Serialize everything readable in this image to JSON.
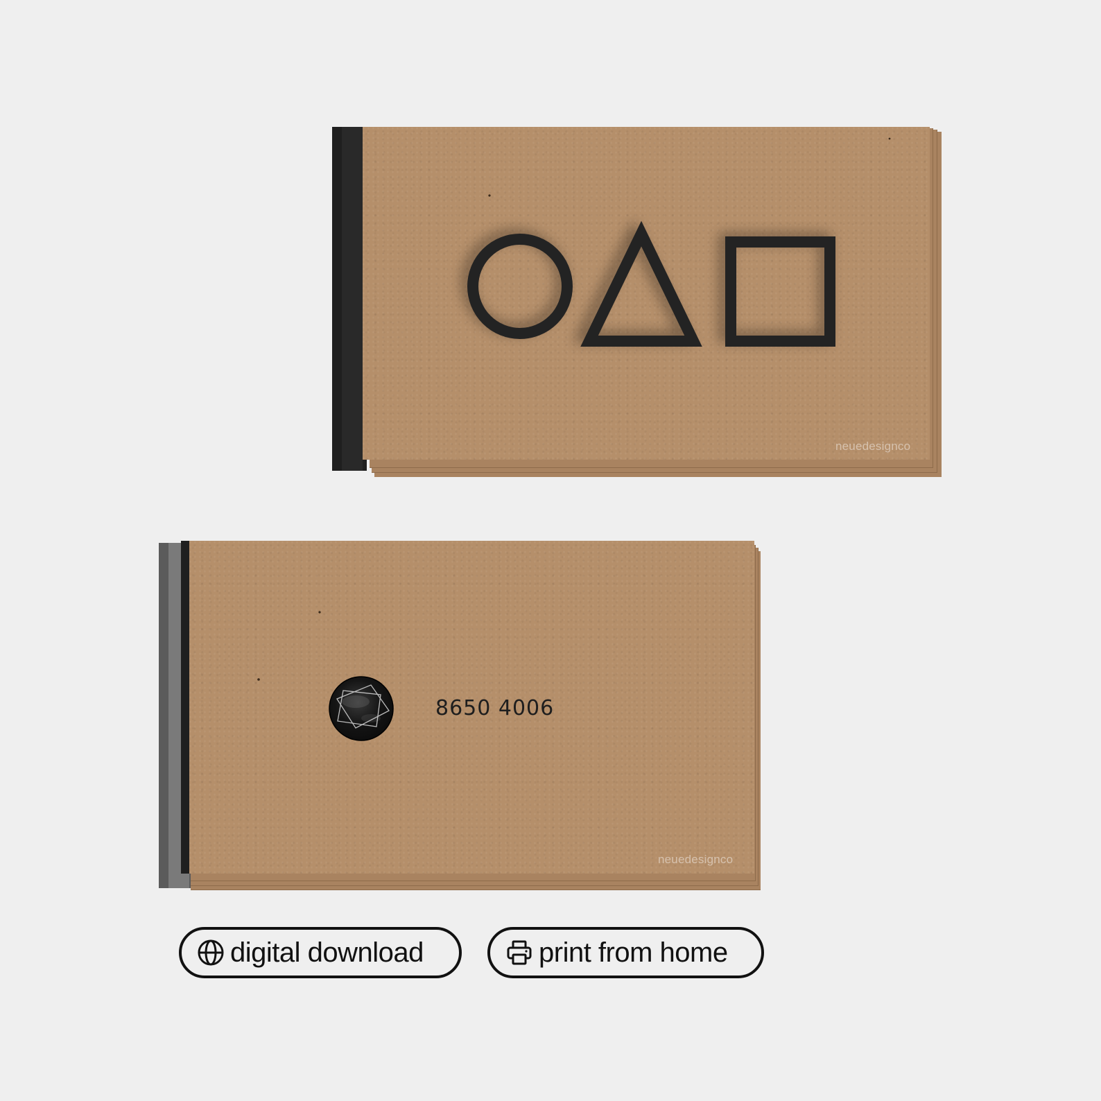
{
  "card_front": {
    "symbols": [
      "circle-icon",
      "triangle-icon",
      "square-icon"
    ],
    "watermark": "neuedesignco"
  },
  "card_back": {
    "logo": "mask-emblem-icon",
    "phone": "8650 4006",
    "watermark": "neuedesignco"
  },
  "badges": {
    "digital_label": "digital download",
    "digital_icon": "globe-icon",
    "print_label": "print from home",
    "print_icon": "printer-icon"
  },
  "colors": {
    "background": "#efefef",
    "kraft": "#b58f6a",
    "ink": "#1f1f1f"
  }
}
